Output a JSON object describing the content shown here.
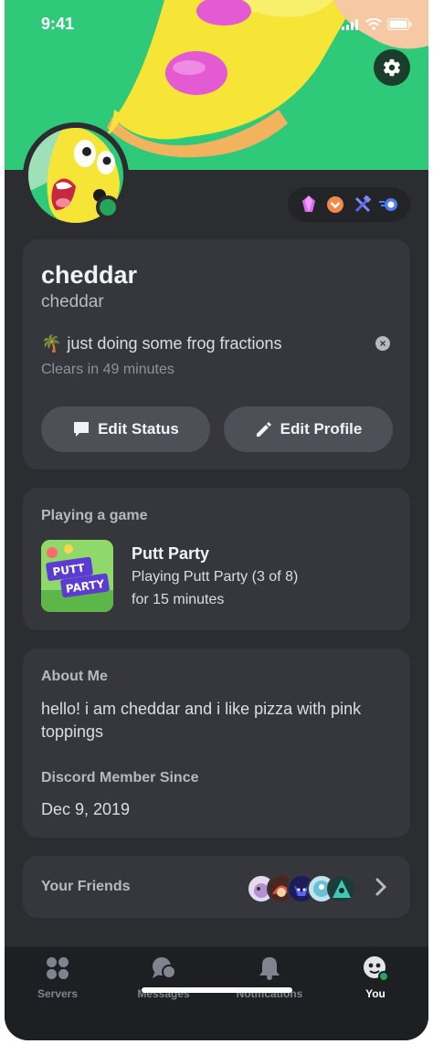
{
  "status_bar": {
    "time": "9:41"
  },
  "profile": {
    "display_name": "cheddar",
    "username": "cheddar",
    "status_emoji": "🌴",
    "status_text": "just doing some frog fractions",
    "status_clear_icon": "close-circle-icon",
    "clears_in": "Clears in 49 minutes",
    "edit_status_label": "Edit Status",
    "edit_profile_label": "Edit Profile"
  },
  "activity": {
    "header": "Playing a game",
    "game_title": "Putt Party",
    "detail": "Playing Putt Party (3 of 8)",
    "duration": "for 15 minutes",
    "game_art_text_top": "PUTT",
    "game_art_text_bottom": "PARTY"
  },
  "about": {
    "header": "About Me",
    "text": "hello! i am cheddar and i like pizza with pink toppings",
    "member_since_header": "Discord Member Since",
    "member_since": "Dec 9, 2019"
  },
  "friends": {
    "label": "Your Friends"
  },
  "tabs": [
    {
      "label": "Servers",
      "icon": "servers-icon"
    },
    {
      "label": "Messages",
      "icon": "messages-icon"
    },
    {
      "label": "Notifications",
      "icon": "bell-icon"
    },
    {
      "label": "You",
      "icon": "you-avatar-icon"
    }
  ],
  "colors": {
    "banner": "#2fc97a",
    "background": "#2b2d31",
    "card": "#36373d",
    "button": "#4e5058",
    "online": "#23a55a",
    "tabbar": "#1e1f22"
  }
}
